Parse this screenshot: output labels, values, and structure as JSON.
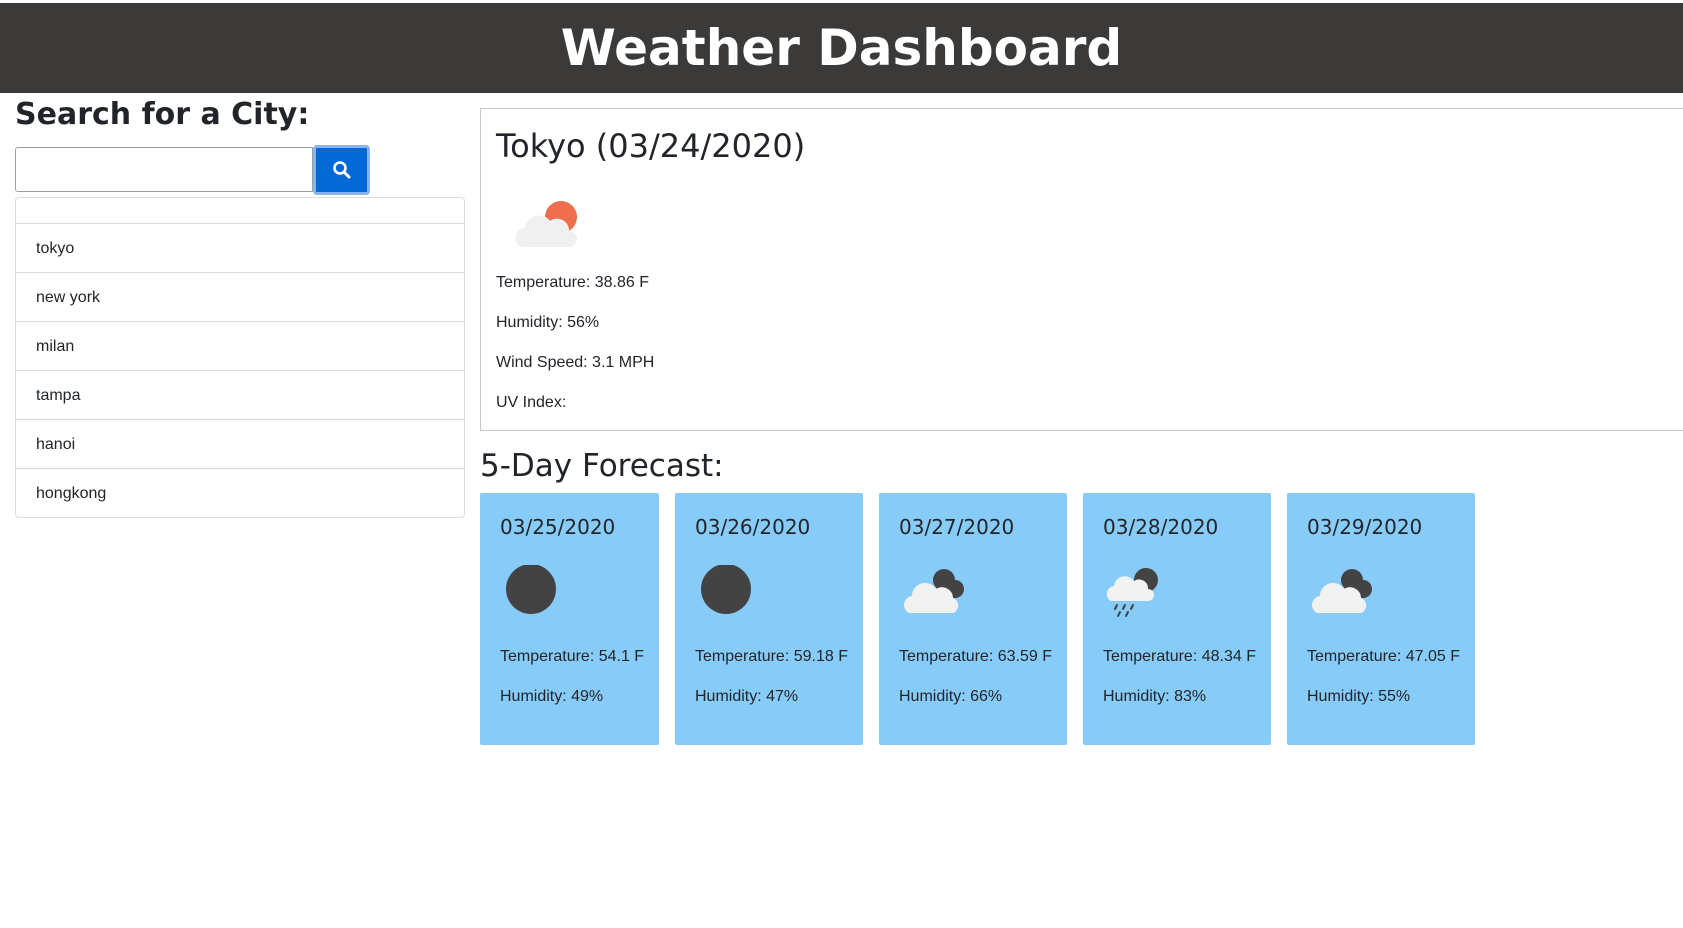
{
  "header": {
    "title": "Weather Dashboard"
  },
  "search": {
    "title": "Search for a City:",
    "input_value": "",
    "button_icon": "search-icon"
  },
  "history": {
    "cities": [
      "tokyo",
      "new york",
      "milan",
      "tampa",
      "hanoi",
      "hongkong"
    ]
  },
  "current": {
    "title": "Tokyo (03/24/2020)",
    "icon": "partly-cloudy-day-icon",
    "temperature": "Temperature: 38.86 F",
    "humidity": "Humidity: 56%",
    "wind": "Wind Speed: 3.1 MPH",
    "uv": "UV Index:"
  },
  "forecast": {
    "title": "5-Day Forecast:",
    "days": [
      {
        "date": "03/25/2020",
        "icon": "clear-night-icon",
        "temperature": "Temperature: 54.1 F",
        "humidity": "Humidity: 49%"
      },
      {
        "date": "03/26/2020",
        "icon": "clear-night-icon",
        "temperature": "Temperature: 59.18 F",
        "humidity": "Humidity: 47%"
      },
      {
        "date": "03/27/2020",
        "icon": "broken-clouds-icon",
        "temperature": "Temperature: 63.59 F",
        "humidity": "Humidity: 66%"
      },
      {
        "date": "03/28/2020",
        "icon": "rain-icon",
        "temperature": "Temperature: 48.34 F",
        "humidity": "Humidity: 83%"
      },
      {
        "date": "03/29/2020",
        "icon": "broken-clouds-icon",
        "temperature": "Temperature: 47.05 F",
        "humidity": "Humidity: 55%"
      }
    ]
  },
  "colors": {
    "header_bg": "#3b3a39",
    "accent_button": "#0468d7",
    "forecast_card_bg": "#87cbf8",
    "icon_dark": "#434343",
    "sun": "#ee6e4d"
  }
}
